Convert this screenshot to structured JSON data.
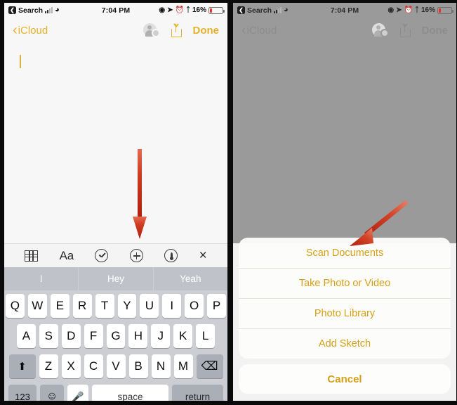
{
  "status_bar": {
    "back_label": "Search",
    "time": "7:04 PM",
    "battery_pct": "16%",
    "icons": [
      "back-chip-icon",
      "signal-bars-icon",
      "wifi-icon",
      "location-icon",
      "navigation-icon",
      "alarm-icon",
      "bluetooth-icon",
      "battery-icon"
    ]
  },
  "nav_bar": {
    "back_label": "iCloud",
    "done_label": "Done",
    "icons": [
      "add-person-icon",
      "share-icon"
    ]
  },
  "note": {
    "body_text": "",
    "caret_visible": true
  },
  "format_toolbar": {
    "items": [
      {
        "name": "table-icon",
        "label": ""
      },
      {
        "name": "text-format-icon",
        "label": "Aa"
      },
      {
        "name": "checklist-icon",
        "label": ""
      },
      {
        "name": "add-attachment-icon",
        "label": ""
      },
      {
        "name": "markup-pen-icon",
        "label": ""
      },
      {
        "name": "close-icon",
        "label": "×"
      }
    ]
  },
  "predictive_bar": {
    "suggestions": [
      "I",
      "Hey",
      "Yeah"
    ]
  },
  "keyboard": {
    "row1": [
      "Q",
      "W",
      "E",
      "R",
      "T",
      "Y",
      "U",
      "I",
      "O",
      "P"
    ],
    "row2": [
      "A",
      "S",
      "D",
      "F",
      "G",
      "H",
      "J",
      "K",
      "L"
    ],
    "row3": [
      "Z",
      "X",
      "C",
      "V",
      "B",
      "N",
      "M"
    ],
    "shift_label": "⬆",
    "backspace_label": "⌫",
    "numbers_label": "123",
    "emoji_label": "☺",
    "mic_label": "⬤",
    "space_label": "space",
    "return_label": "return"
  },
  "action_sheet": {
    "items": [
      "Scan Documents",
      "Take Photo or Video",
      "Photo Library",
      "Add Sketch"
    ],
    "cancel_label": "Cancel"
  },
  "annotations": {
    "arrow_left": "red-down-arrow",
    "arrow_right": "red-diagonal-arrow"
  },
  "colors": {
    "accent_gold": "#e5b229",
    "sheet_gold": "#d4a017",
    "arrow_red": "#c62a18",
    "keyboard_bg": "#ccced3",
    "dim_overlay": "#9a9a9a"
  }
}
